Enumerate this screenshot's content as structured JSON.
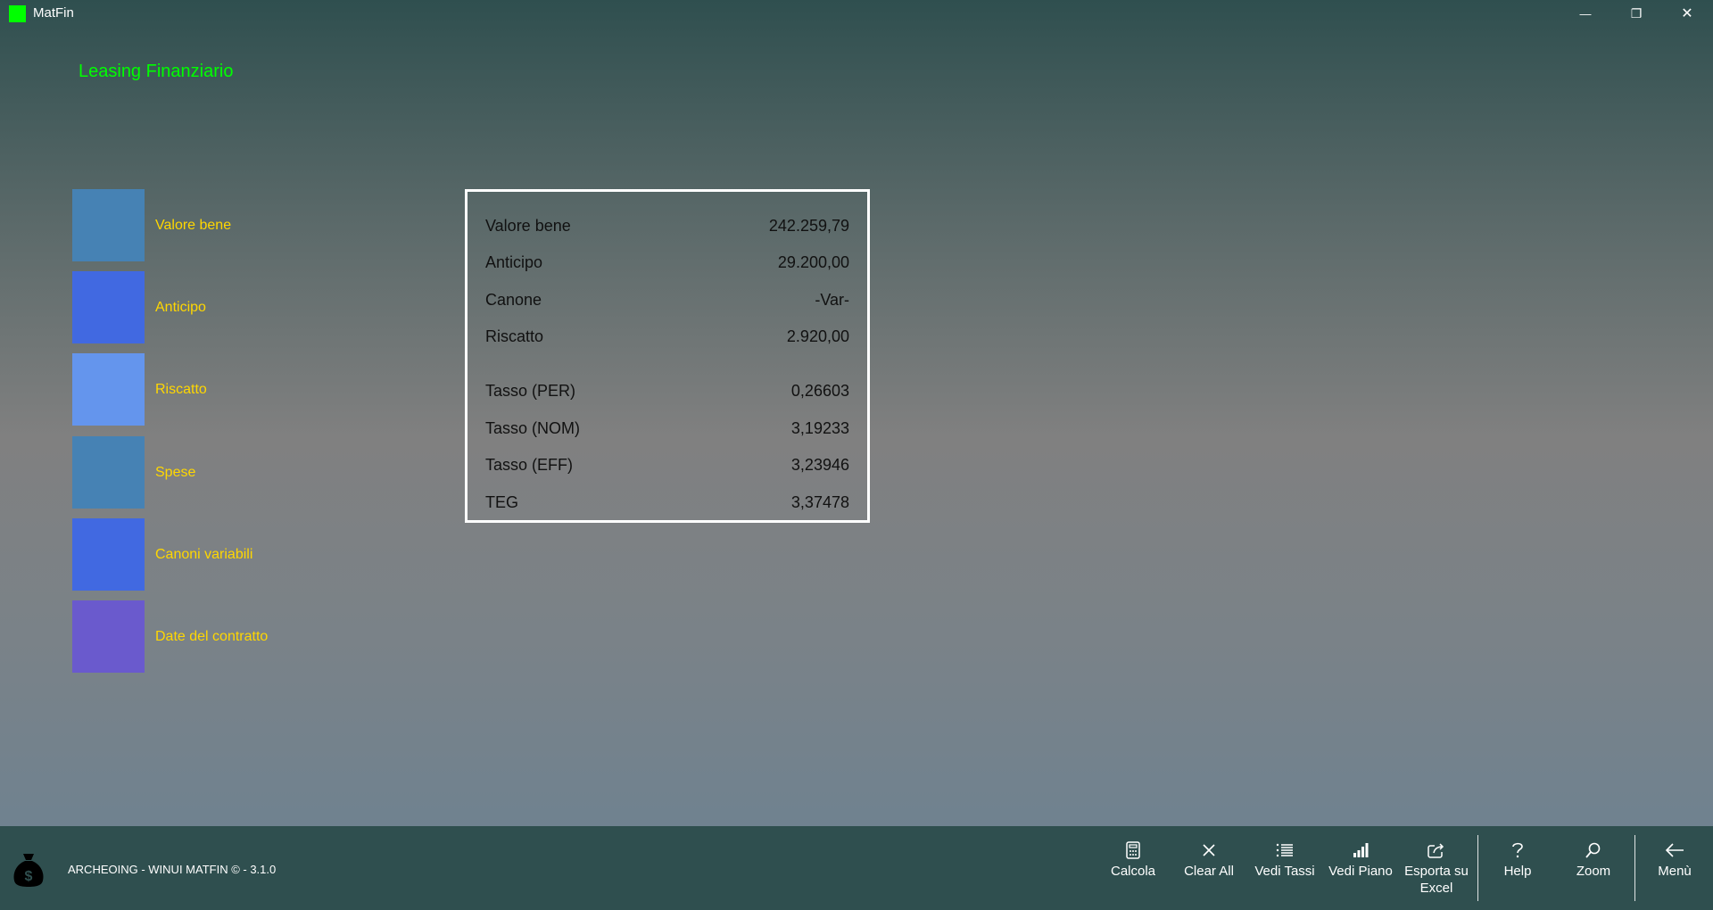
{
  "window": {
    "title": "MatFin",
    "minimize_glyph": "—",
    "maximize_glyph": "❐",
    "close_glyph": "✕"
  },
  "page": {
    "title": "Leasing Finanziario"
  },
  "menu": {
    "items": [
      {
        "label": "Valore bene",
        "color": "#4682b4"
      },
      {
        "label": "Anticipo",
        "color": "#4169e1"
      },
      {
        "label": "Riscatto",
        "color": "#6495ed"
      },
      {
        "label": "Spese",
        "color": "#4682b4"
      },
      {
        "label": "Canoni variabili",
        "color": "#4169e1"
      },
      {
        "label": "Date del contratto",
        "color": "#6a5acd"
      }
    ]
  },
  "results": {
    "rows": [
      {
        "label": "Valore bene",
        "value": "242.259,79"
      },
      {
        "label": "Anticipo",
        "value": "29.200,00"
      },
      {
        "label": "Canone",
        "value": "-Var-"
      },
      {
        "label": "Riscatto",
        "value": "2.920,00"
      },
      {
        "label": "Tasso (PER)",
        "value": "0,26603"
      },
      {
        "label": "Tasso (NOM)",
        "value": "3,19233"
      },
      {
        "label": "Tasso (EFF)",
        "value": "3,23946"
      },
      {
        "label": "TEG",
        "value": "3,37478"
      }
    ]
  },
  "footer": {
    "text": "ARCHEOING - WINUI MATFIN © - 3.1.0",
    "bag_symbol": "$"
  },
  "commands": {
    "calcola": "Calcola",
    "clear_all": "Clear All",
    "vedi_tassi": "Vedi Tassi",
    "vedi_piano": "Vedi Piano",
    "esporta_line1": "Esporta su",
    "esporta_line2": "Excel",
    "help": "Help",
    "zoom": "Zoom",
    "menu": "Menù"
  },
  "colors": {
    "accent_green": "#00ff00",
    "label_gold": "#ffd700",
    "bar_bg": "#2f4f4f"
  }
}
